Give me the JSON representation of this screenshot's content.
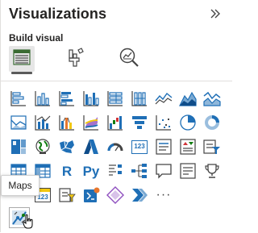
{
  "pane": {
    "title": "Visualizations",
    "subtitle": "Build visual",
    "collapse_icon": "double-chevron-right-icon"
  },
  "tabs": [
    {
      "name": "build-visual",
      "icon": "table-fields-icon",
      "active": true
    },
    {
      "name": "format-visual",
      "icon": "paintbrush-format-icon",
      "active": false
    },
    {
      "name": "analytics",
      "icon": "magnify-analytics-icon",
      "active": false
    }
  ],
  "visuals": {
    "r_visual": "R",
    "python_visual": "Py",
    "card": "123",
    "multirow_card": "123",
    "more": "···"
  },
  "tooltip": "Maps",
  "selected_visual": "arcgis-maps-icon",
  "colors": {
    "blue": "#1f6fb6",
    "blue_dark": "#0f4d8a",
    "yellow": "#f2c811",
    "orange": "#e8772e",
    "purple": "#8f4fbf",
    "red": "#d13438",
    "green": "#107c10"
  }
}
